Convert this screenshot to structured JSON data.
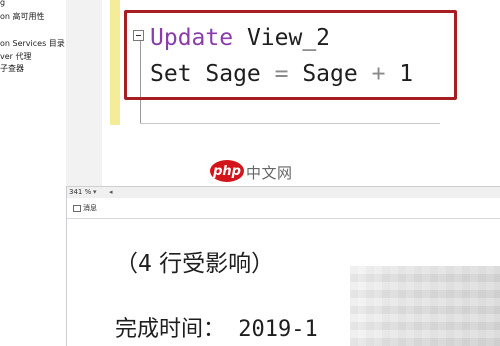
{
  "object_explorer": {
    "items": [
      "g",
      "on 高可用性",
      "",
      "on Services 目录",
      "ver 代理",
      "子查器"
    ]
  },
  "editor": {
    "line1_keyword": "Update",
    "line1_rest": " View_2",
    "line2_a": "Set Sage ",
    "line2_eq": "=",
    "line2_b": " Sage ",
    "line2_plus": "+",
    "line2_c": " 1"
  },
  "zoom": {
    "value": "341 %",
    "arrow": "▾",
    "scroll_left": "◂"
  },
  "watermark": {
    "logo": "php",
    "text": "中文网"
  },
  "results": {
    "tab_label": "消息",
    "rows_affected_paren": "（4",
    "rows_affected_text": " 行受影响）",
    "completion_label": "完成时间：",
    "completion_value": " 2019-1"
  }
}
